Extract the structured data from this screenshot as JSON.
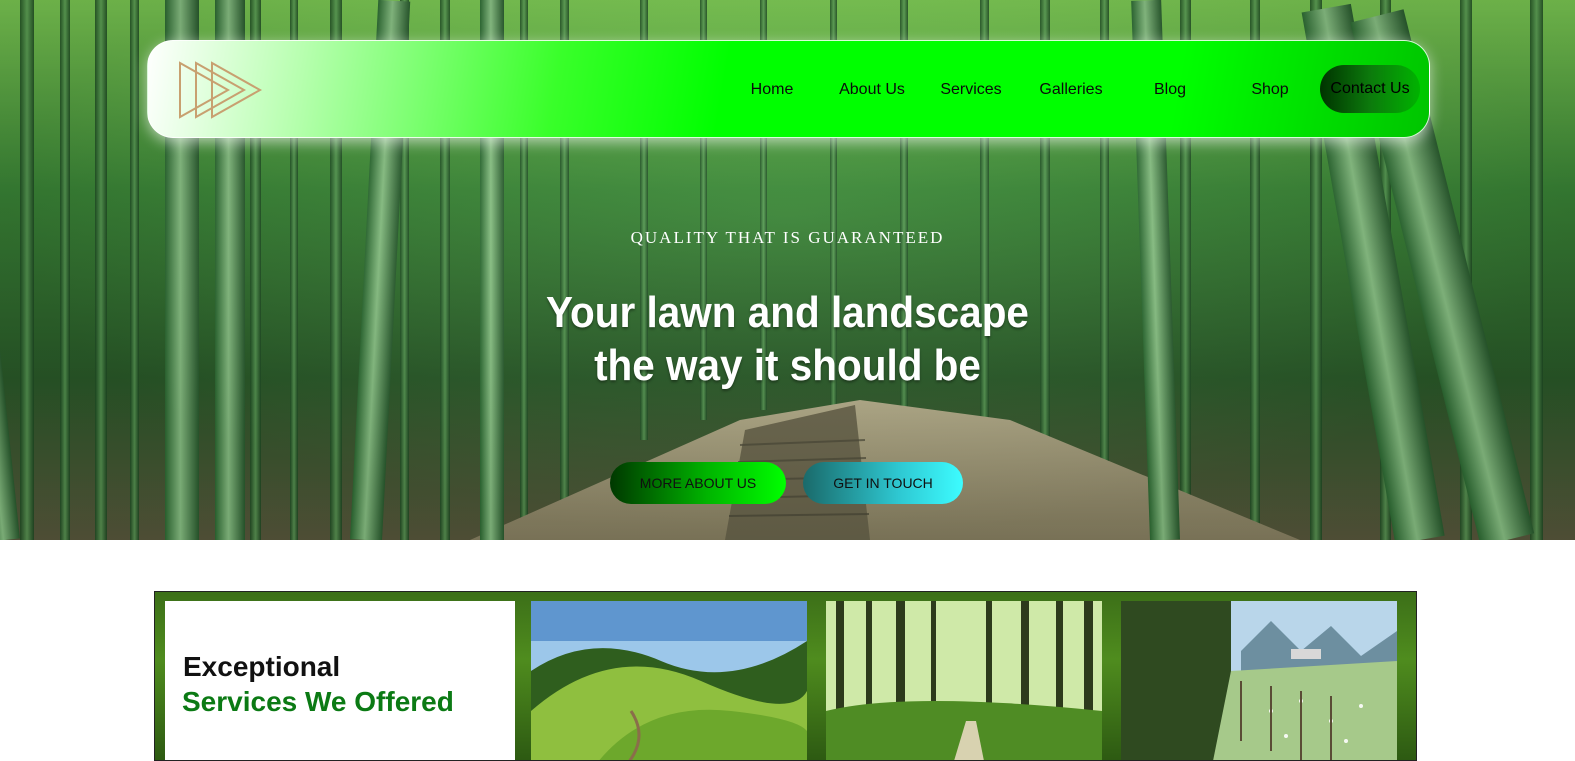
{
  "nav": {
    "logo_icon": "triangles-logo-icon",
    "items": [
      {
        "label": "Home"
      },
      {
        "label": "About Us"
      },
      {
        "label": "Services"
      },
      {
        "label": "Galleries"
      },
      {
        "label": "Blog"
      },
      {
        "label": "Shop"
      }
    ],
    "contact_label": "Contact Us"
  },
  "hero": {
    "eyebrow": "QUALITY THAT IS GUARANTEED",
    "headline_line1": "Your lawn and landscape",
    "headline_line2": "the way it should be",
    "buttons": {
      "more": "MORE ABOUT US",
      "touch": "GET IN TOUCH"
    },
    "background": "bamboo-forest-image"
  },
  "services": {
    "title_line1": "Exceptional",
    "title_line2": "Services We Offered",
    "images": [
      "green-hills-image",
      "forest-path-image",
      "meadow-fence-image"
    ]
  },
  "colors": {
    "nav_green": "#00ff00",
    "services_green": "#0b7a14",
    "touch_cyan": "#3dfcff"
  }
}
